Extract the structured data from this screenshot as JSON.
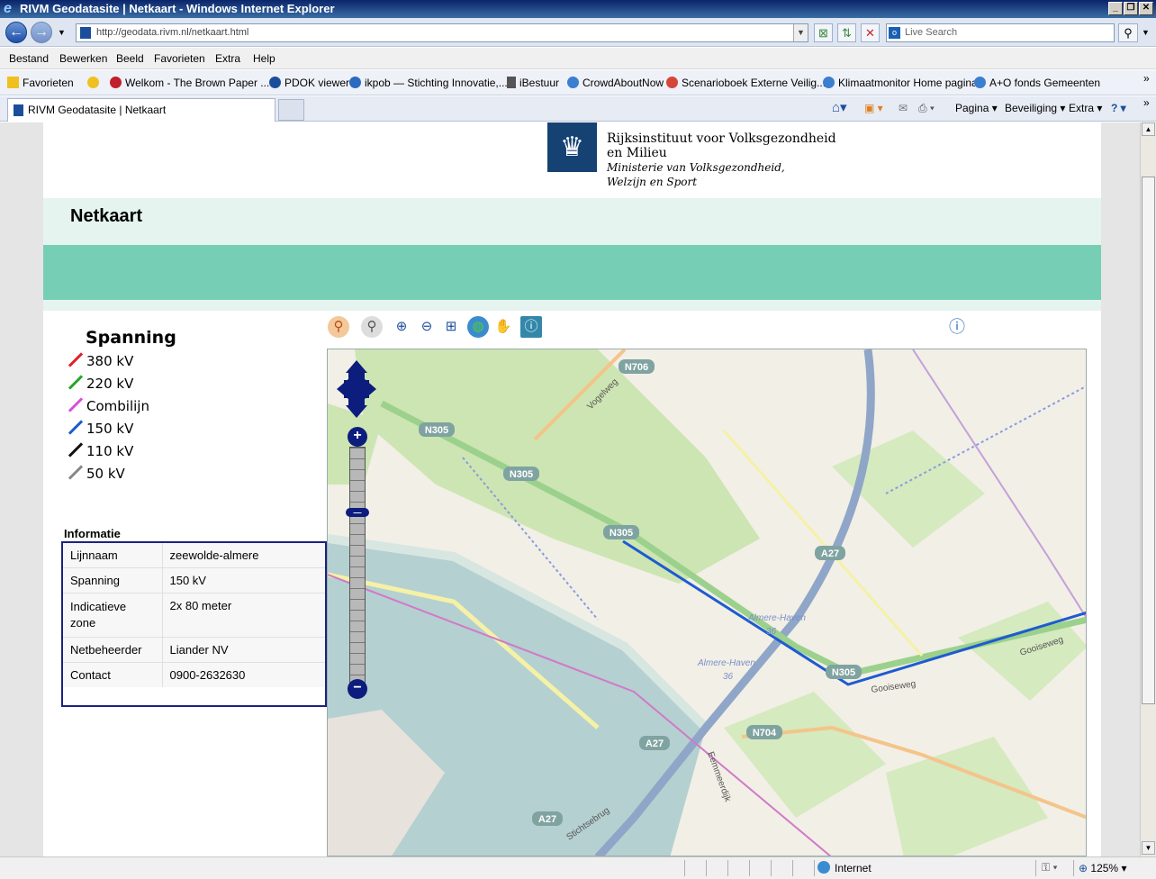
{
  "window": {
    "title": "RIVM Geodatasite | Netkaart - Windows Internet Explorer"
  },
  "address": {
    "url": "http://geodata.rivm.nl/netkaart.html",
    "search_placeholder": "Live Search"
  },
  "menu": [
    "Bestand",
    "Bewerken",
    "Beeld",
    "Favorieten",
    "Extra",
    "Help"
  ],
  "favorites": {
    "label": "Favorieten",
    "items": [
      "Welkom - The Brown Paper ...",
      "PDOK viewer",
      "ikpob — Stichting Innovatie,...",
      "iBestuur",
      "CrowdAboutNow",
      "Scenarioboek Externe Veilig...",
      "Klimaatmonitor  Home pagina",
      "A+O fonds Gemeenten"
    ]
  },
  "tab": {
    "label": "RIVM Geodatasite | Netkaart"
  },
  "commands": {
    "pagina": "Pagina",
    "beveiliging": "Beveiliging",
    "extra": "Extra"
  },
  "header": {
    "org_line1": "Rijksinstituut voor Volksgezondheid",
    "org_line2": "en Milieu",
    "ministry_line1": "Ministerie van Volksgezondheid,",
    "ministry_line2": "Welzijn en Sport",
    "page_title": "Netkaart"
  },
  "legend": {
    "title": "Spanning",
    "items": [
      {
        "label": "380 kV",
        "color": "#e0202a"
      },
      {
        "label": "220 kV",
        "color": "#2aa52a"
      },
      {
        "label": "Combilijn",
        "color": "#d94fd9"
      },
      {
        "label": "150 kV",
        "color": "#1e5bd0"
      },
      {
        "label": "110 kV",
        "color": "#111111"
      },
      {
        "label": "50 kV",
        "color": "#888888"
      }
    ]
  },
  "info": {
    "title": "Informatie",
    "rows": [
      {
        "key": "Lijnnaam",
        "value": "zeewolde-almere"
      },
      {
        "key": "Spanning",
        "value": "150 kV"
      },
      {
        "key": "Indicatieve zone",
        "value": "2x 80 meter"
      },
      {
        "key": "Netbeheerder",
        "value": "Liander NV"
      },
      {
        "key": "Contact",
        "value": "0900-2632630"
      }
    ]
  },
  "map": {
    "labels": {
      "n706": "N706",
      "n305a": "N305",
      "n305b": "N305",
      "n305c": "N305",
      "n305d": "N305",
      "n704": "N704",
      "a27a": "A27",
      "a27b": "A27",
      "a27c": "A27",
      "vogelweg": "Vogelweg",
      "gooiseweg": "Gooiseweg",
      "gooiseweg2": "Gooiseweg",
      "almerehaven1": "Almere-Haven",
      "almerehaven2": "Almere-Haven",
      "num36a": "36",
      "num36b": "36",
      "stichtsebrug": "Stichtsebrug",
      "eemmeerdijk": "Eemmeerdijk"
    }
  },
  "status": {
    "zone": "Internet",
    "zoom": "125%"
  }
}
